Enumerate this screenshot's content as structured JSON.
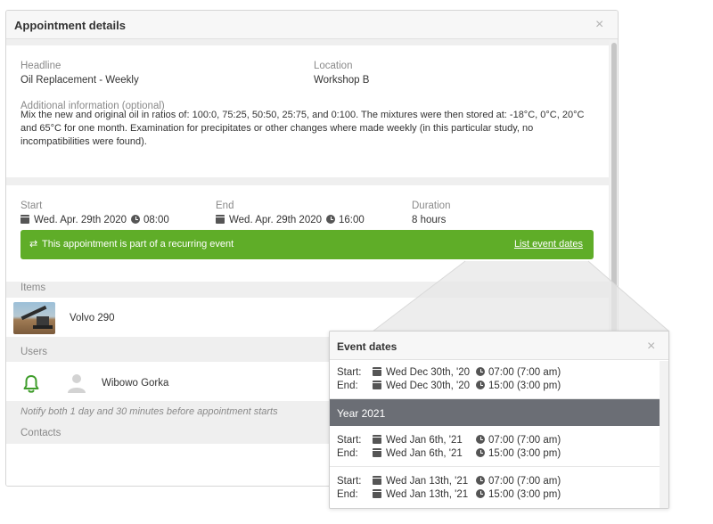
{
  "modal": {
    "title": "Appointment details",
    "close_glyph": "×",
    "headline_label": "Headline",
    "headline_value": "Oil Replacement - Weekly",
    "location_label": "Location",
    "location_value": "Workshop B",
    "info_label": "Additional information (optional)",
    "info_text": "Mix the new and original oil in ratios of: 100:0, 75:25, 50:50, 25:75, and 0:100. The mixtures were then stored at: -18°C, 0°C, 20°C and 65°C for one month. Examination for precipitates or other changes where made weekly (in this particular study, no incompatibilities were found).",
    "start_label": "Start",
    "start_date": "Wed. Apr. 29th 2020",
    "start_time": "08:00",
    "end_label": "End",
    "end_date": "Wed. Apr. 29th 2020",
    "end_time": "16:00",
    "duration_label": "Duration",
    "duration_value": "8 hours",
    "recurring_text": "This appointment is part of a recurring event",
    "recurring_icon": "⇄",
    "recurring_link": "List event dates",
    "items_label": "Items",
    "item_name": "Volvo 290",
    "users_label": "Users",
    "user_name": "Wibowo Gorka",
    "notify_text": "Notify both 1 day and 30 minutes before appointment starts",
    "contacts_label": "Contacts"
  },
  "events_popup": {
    "title": "Event dates",
    "close_glyph": "×",
    "start_label": "Start:",
    "end_label": "End:",
    "year_label": "Year 2021",
    "entries": [
      {
        "start_date": "Wed Dec 30th, '20",
        "start_time": "07:00 (7:00 am)",
        "end_date": "Wed Dec 30th, '20",
        "end_time": "15:00 (3:00 pm)"
      },
      {
        "start_date": "Wed Jan 6th, '21",
        "start_time": "07:00 (7:00 am)",
        "end_date": "Wed Jan 6th, '21",
        "end_time": "15:00 (3:00 pm)"
      },
      {
        "start_date": "Wed Jan 13th, '21",
        "start_time": "07:00 (7:00 am)",
        "end_date": "Wed Jan 13th, '21",
        "end_time": "15:00 (3:00 pm)"
      }
    ]
  },
  "colors": {
    "accent_green": "#5fad28",
    "year_bar": "#6b6e75",
    "bell_green": "#3f9d2b"
  },
  "icons": [
    "close-icon",
    "calendar-icon",
    "clock-icon",
    "recurring-icon",
    "bell-icon",
    "user-avatar-icon"
  ]
}
